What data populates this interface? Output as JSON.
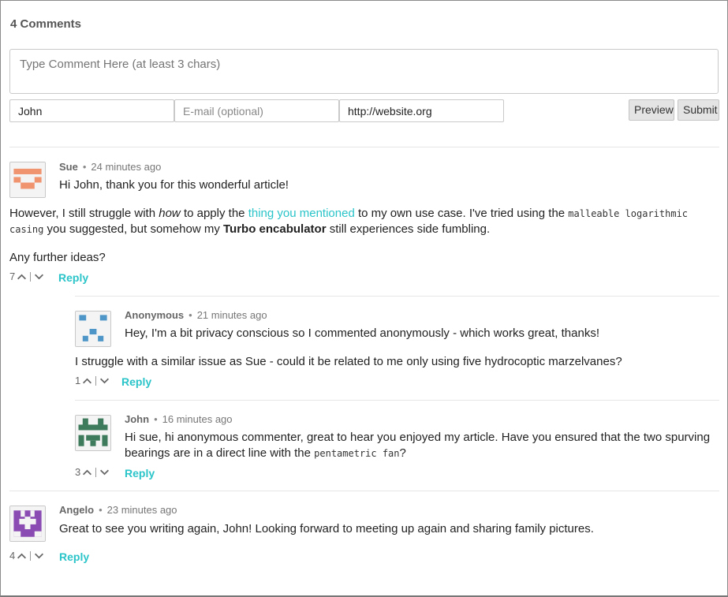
{
  "comments_count": "4 Comments",
  "form": {
    "comment_placeholder": "Type Comment Here (at least 3 chars)",
    "name_value": "John",
    "email_placeholder": "E-mail (optional)",
    "website_value": "http://website.org",
    "preview_label": "Preview",
    "submit_label": "Submit"
  },
  "comments": [
    {
      "author": "Sue",
      "time": "24 minutes ago",
      "greeting": "Hi John, thank you for this wonderful article!",
      "p1_a": "However, I still struggle with ",
      "p1_em": "how",
      "p1_b": " to apply the ",
      "p1_link": "thing you mentioned",
      "p1_c": " to my own use case. I've tried using the ",
      "p1_code1": "malleable logarithmic",
      "p1_code2": "casing",
      "p1_d": " you suggested, but somehow my ",
      "p1_strong": "Turbo encabulator",
      "p1_e": " still experiences side fumbling.",
      "p2": "Any further ideas?",
      "votes": "7",
      "reply": "Reply",
      "avatar_color": "#f0936f"
    },
    {
      "author": "Anonymous",
      "time": "21 minutes ago",
      "greeting": "Hey, I'm a bit privacy conscious so I commented anonymously - which works great, thanks!",
      "p1": "I struggle with a similar issue as Sue - could it be related to me only using five hydrocoptic marzelvanes?",
      "votes": "1",
      "reply": "Reply",
      "avatar_color": "#4e96c7"
    },
    {
      "author": "John",
      "time": "16 minutes ago",
      "text_a": "Hi sue, hi anonymous commenter, great to hear you enjoyed my article. Have you ensured that the two spurving",
      "text_b": "bearings are in a direct line with the ",
      "text_code": "pentametric fan",
      "text_c": "?",
      "votes": "3",
      "reply": "Reply",
      "avatar_color": "#3e7a5c"
    },
    {
      "author": "Angelo",
      "time": "23 minutes ago",
      "text": "Great to see you writing again, John! Looking forward to meeting up again and sharing family pictures.",
      "votes": "4",
      "reply": "Reply",
      "avatar_color": "#8a4bb3"
    }
  ],
  "colors": {
    "link": "#2ac4c9"
  }
}
